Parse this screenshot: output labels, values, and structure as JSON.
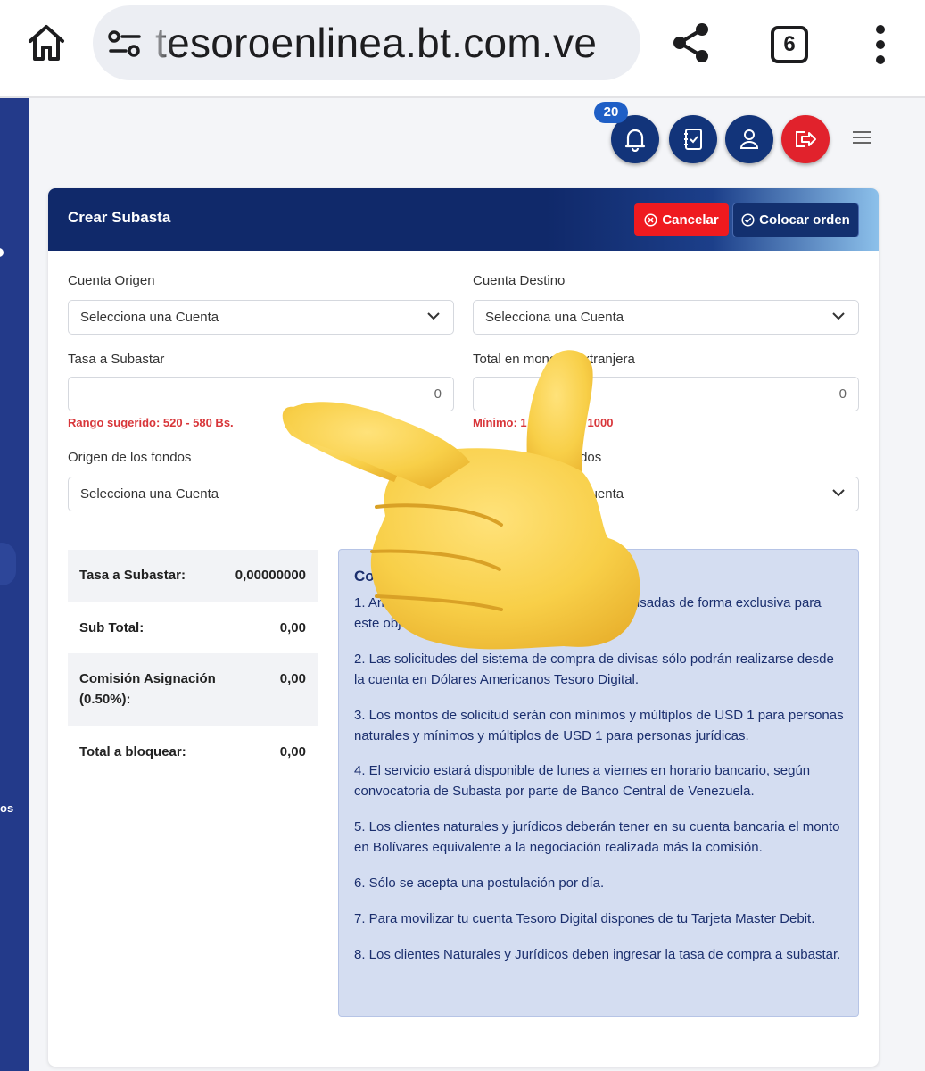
{
  "browser": {
    "url": "tesoroenlinea.bt.com.ve",
    "tab_count": "6"
  },
  "topbar": {
    "notification_count": "20"
  },
  "sidebar": {
    "fragment": "os"
  },
  "card": {
    "title": "Crear Subasta",
    "cancel_label": "Cancelar",
    "place_order_label": "Colocar orden"
  },
  "form": {
    "cuenta_origen": {
      "label": "Cuenta Origen",
      "value": "Selecciona una Cuenta"
    },
    "cuenta_destino": {
      "label": "Cuenta Destino",
      "value": "Selecciona una Cuenta"
    },
    "tasa": {
      "label": "Tasa a Subastar",
      "value": "0",
      "hint": "Rango sugerido: 520 - 580 Bs."
    },
    "total": {
      "label": "Total en moneda extranjera",
      "value": "0",
      "hint": "Mínimo: 1 - Máximo: 1000"
    },
    "origen_fondos": {
      "label": "Origen de los fondos",
      "value": "Selecciona una Cuenta"
    },
    "destino_fondos": {
      "label": "Destino de los fondos",
      "value": "Selecciona una Cuenta"
    }
  },
  "summary": [
    {
      "label": "Tasa a Subastar:",
      "value": "0,00000000"
    },
    {
      "label": "Sub Total:",
      "value": "0,00"
    },
    {
      "label": "Comisión Asignación (0.50%):",
      "value": "0,00"
    },
    {
      "label": "Total a bloquear:",
      "value": "0,00"
    }
  ],
  "conditions": {
    "title": "Condiciones",
    "items": [
      "1. Ambas cuentas designadas sólo podrán ser usadas de forma exclusiva para este objetivo.",
      "2. Las solicitudes del sistema de compra de divisas sólo podrán realizarse desde la cuenta en Dólares Americanos Tesoro Digital.",
      "3. Los montos de solicitud serán con mínimos y múltiplos de USD 1 para personas naturales y mínimos y múltiplos de USD 1 para personas jurídicas.",
      "4. El servicio estará disponible de lunes a viernes en horario bancario, según convocatoria de Subasta por parte de Banco Central de Venezuela.",
      "5. Los clientes naturales y jurídicos deberán tener en su cuenta bancaria el monto en Bolívares equivalente a la negociación realizada más la comisión.",
      "6. Sólo se acepta una postulación por día.",
      "7. Para movilizar tu cuenta Tesoro Digital dispones de tu Tarjeta Master Debit.",
      "8. Los clientes Naturales y Jurídicos deben ingresar la tasa de compra a subastar."
    ]
  },
  "overlay": {
    "icon": "pointing-hand-emoji"
  }
}
